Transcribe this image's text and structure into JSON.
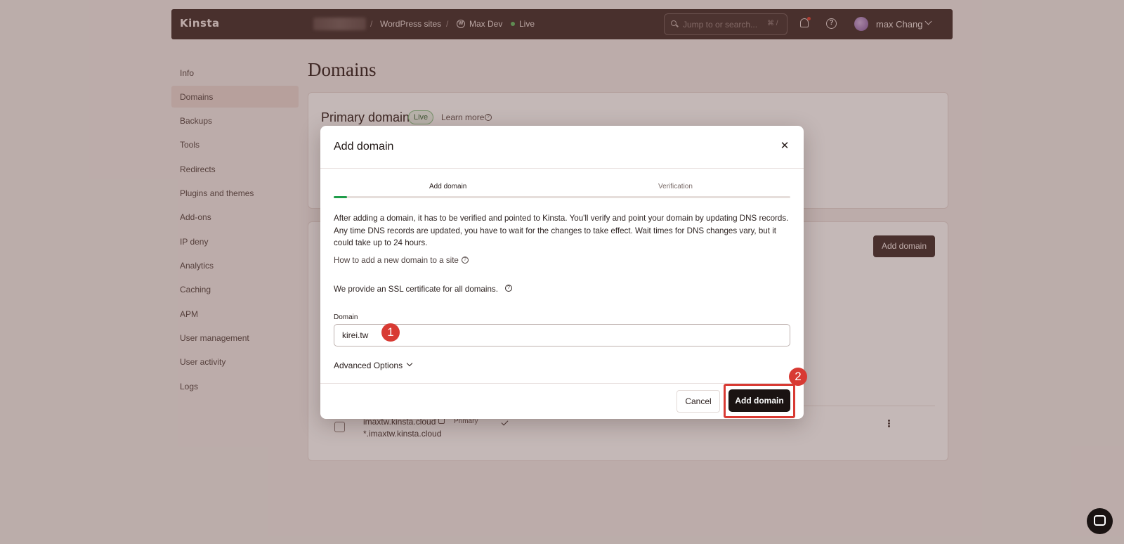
{
  "topbar": {
    "logo": "Kinsta",
    "breadcrumb_sep1": "/",
    "breadcrumb_sep2": "/",
    "wp_sites": "WordPress sites",
    "site_name": "Max Dev",
    "env": "Live",
    "search_placeholder": "Jump to or search...",
    "search_shortcut": "⌘ /",
    "user_name": "max Chang"
  },
  "sidebar": {
    "items": [
      {
        "label": "Info"
      },
      {
        "label": "Domains"
      },
      {
        "label": "Backups"
      },
      {
        "label": "Tools"
      },
      {
        "label": "Redirects"
      },
      {
        "label": "Plugins and themes"
      },
      {
        "label": "Add-ons"
      },
      {
        "label": "IP deny"
      },
      {
        "label": "Analytics"
      },
      {
        "label": "Caching"
      },
      {
        "label": "APM"
      },
      {
        "label": "User management"
      },
      {
        "label": "User activity"
      },
      {
        "label": "Logs"
      }
    ],
    "active": "Domains"
  },
  "main": {
    "title": "Domains",
    "primary_domain_title": "Primary domain",
    "primary_badge": "Live",
    "learn_more": "Learn more",
    "add_domain_button": "Add domain",
    "row": {
      "domain": "imaxtw.kinsta.cloud",
      "tag": "Primary",
      "wildcard": "*.imaxtw.kinsta.cloud"
    }
  },
  "modal": {
    "title": "Add domain",
    "steps": [
      "Add domain",
      "Verification"
    ],
    "progress": 0.03,
    "description": "After adding a domain, it has to be verified and pointed to Kinsta. You'll verify and point your domain by updating DNS records. Any time DNS records are updated, you have to wait for the changes to take effect. Wait times for DNS changes vary, but it could take up to 24 hours.",
    "howto_link": "How to add a new domain to a site",
    "ssl_note": "We provide an SSL certificate for all domains.",
    "domain_label": "Domain",
    "domain_value": "kirei.tw",
    "advanced_options": "Advanced Options",
    "cancel_label": "Cancel",
    "submit_label": "Add domain"
  },
  "annotations": {
    "marker1": "1",
    "marker2": "2",
    "color": "#d83a33"
  },
  "colors": {
    "topbar": "#4a3734",
    "accent_green": "#1f9d4a",
    "primary_button": "#1a1312"
  }
}
